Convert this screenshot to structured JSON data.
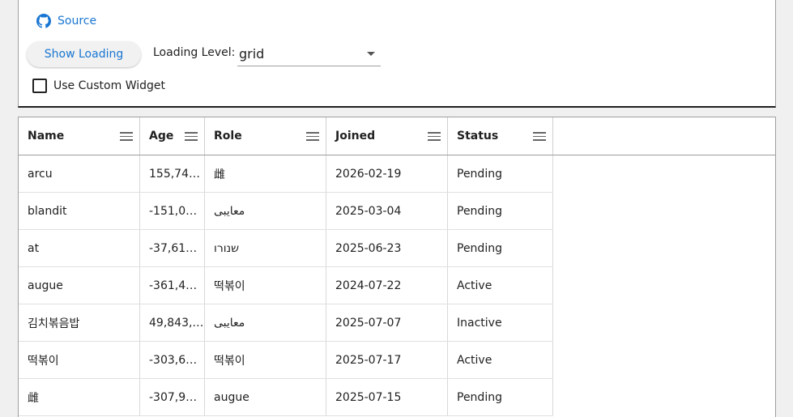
{
  "toolbar": {
    "source_label": "Source",
    "show_loading_label": "Show Loading",
    "loading_level_label": "Loading Level:",
    "loading_level_value": "grid",
    "custom_widget_label": "Use Custom Widget",
    "custom_widget_checked": false
  },
  "colors": {
    "accent": "#1976d2"
  },
  "grid": {
    "columns": [
      "Name",
      "Age",
      "Role",
      "Joined",
      "Status"
    ],
    "rows": [
      [
        "arcu",
        "155,74…",
        "雌",
        "2026-02-19",
        "Pending"
      ],
      [
        "blandit",
        "-151,0…",
        "معايبی",
        "2025-03-04",
        "Pending"
      ],
      [
        "at",
        "-37,61…",
        "שנורו",
        "2025-06-23",
        "Pending"
      ],
      [
        "augue",
        "-361,4…",
        "떡볶이",
        "2024-07-22",
        "Active"
      ],
      [
        "김치볶음밥",
        "49,843,…",
        "معايبی",
        "2025-07-07",
        "Inactive"
      ],
      [
        "떡볶이",
        "-303,6…",
        "떡볶이",
        "2025-07-17",
        "Active"
      ],
      [
        "雌",
        "-307,9…",
        "augue",
        "2025-07-15",
        "Pending"
      ]
    ]
  }
}
